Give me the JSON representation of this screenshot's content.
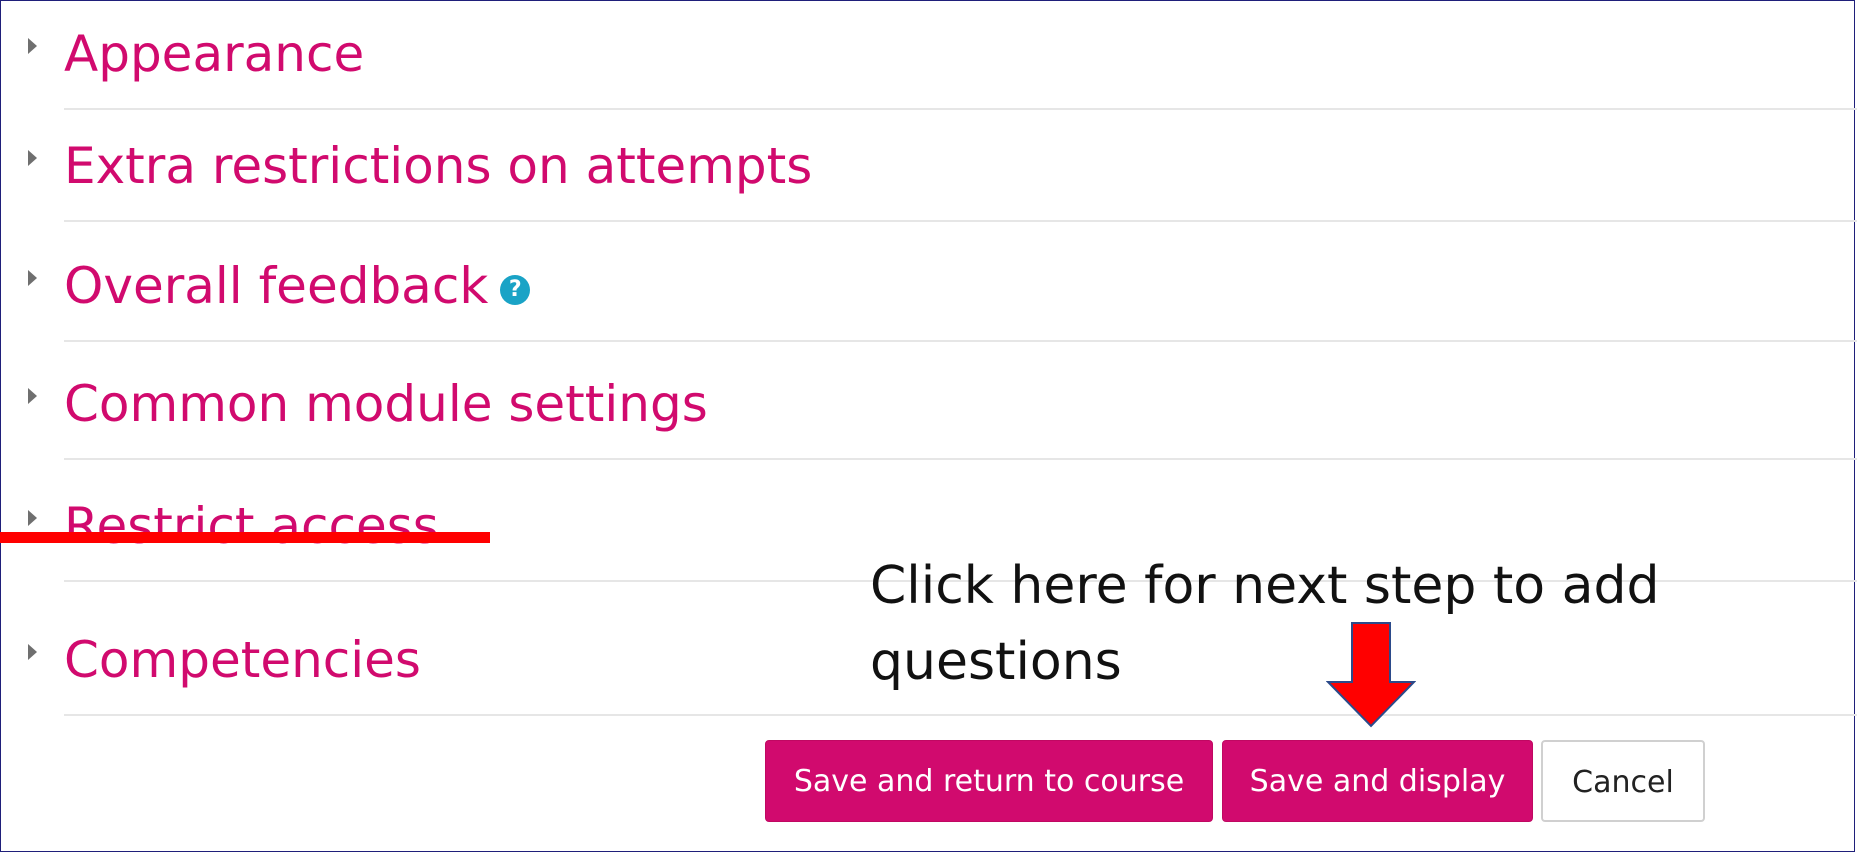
{
  "sections": [
    {
      "label": "Appearance",
      "has_help": false
    },
    {
      "label": "Extra restrictions on attempts",
      "has_help": false
    },
    {
      "label": "Overall feedback",
      "has_help": true
    },
    {
      "label": "Common module settings",
      "has_help": false
    },
    {
      "label": "Restrict access",
      "has_help": false,
      "struck_out": true
    },
    {
      "label": "Competencies",
      "has_help": false
    }
  ],
  "help_icon_glyph": "?",
  "annotation": {
    "text": "Click here for next step to add questions",
    "arrow_color": "#ff0000",
    "strike_color": "#ff0000"
  },
  "buttons": {
    "save_return": "Save and return to course",
    "save_display": "Save and display",
    "cancel": "Cancel"
  },
  "colors": {
    "accent": "#d10a6e",
    "help_icon": "#1aa3c6",
    "border": "#1f1f7a"
  }
}
